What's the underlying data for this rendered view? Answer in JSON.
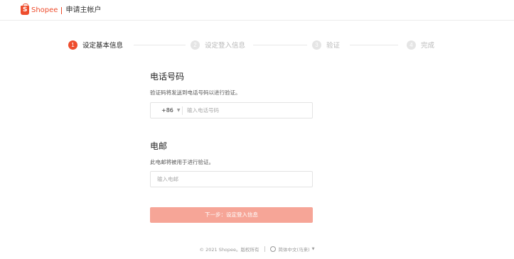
{
  "header": {
    "brand": "Shopee",
    "logo_letter": "S",
    "title": "申请主帐户"
  },
  "steps": [
    {
      "num": "1",
      "label": "设定基本信息",
      "active": true
    },
    {
      "num": "2",
      "label": "设定登入信息",
      "active": false
    },
    {
      "num": "3",
      "label": "验证",
      "active": false
    },
    {
      "num": "4",
      "label": "完成",
      "active": false
    }
  ],
  "phone": {
    "title": "电话号码",
    "desc": "验证码将发送到电话号码以进行验证。",
    "country_code": "+86",
    "placeholder": "输入电话号码"
  },
  "email": {
    "title": "电邮",
    "desc": "此电邮将被用于进行验证。",
    "placeholder": "输入电邮"
  },
  "next_button": "下一步：设定登入信息",
  "footer": {
    "copyright": "© 2021 Shopee。版权所有",
    "language": "简体中文(马来)"
  },
  "colors": {
    "brand": "#ee4d2d",
    "button_disabled": "#f6a597"
  }
}
